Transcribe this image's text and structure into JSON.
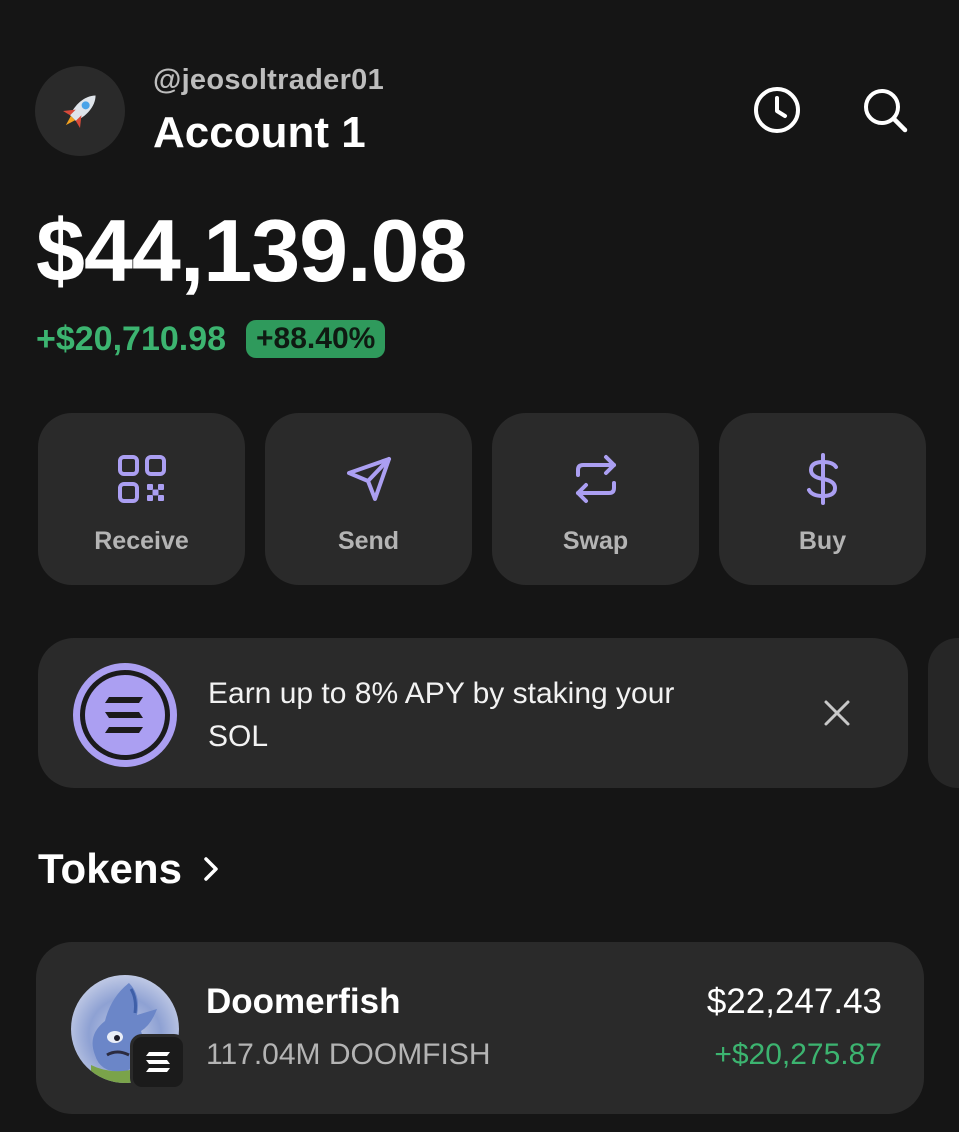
{
  "header": {
    "username": "@jeosoltrader01",
    "account_name": "Account 1",
    "avatar_icon": "rocket-icon",
    "history_icon": "clock-icon",
    "search_icon": "search-icon"
  },
  "portfolio": {
    "balance": "$44,139.08",
    "change_amount": "+$20,710.98",
    "change_percent": "+88.40%"
  },
  "actions": [
    {
      "label": "Receive",
      "icon": "qr-code-icon"
    },
    {
      "label": "Send",
      "icon": "send-icon"
    },
    {
      "label": "Swap",
      "icon": "swap-icon"
    },
    {
      "label": "Buy",
      "icon": "dollar-icon"
    }
  ],
  "promo": {
    "text": "Earn up to 8% APY by staking your SOL",
    "icon": "solana-icon",
    "close_icon": "close-icon"
  },
  "tokens": {
    "heading": "Tokens",
    "items": [
      {
        "name": "Doomerfish",
        "amount": "117.04M DOOMFISH",
        "value": "$22,247.43",
        "pnl": "+$20,275.87"
      }
    ]
  },
  "colors": {
    "background": "#151515",
    "card": "#2a2a2a",
    "accent_purple": "#ab9ff2",
    "positive_green": "#3cb470"
  }
}
